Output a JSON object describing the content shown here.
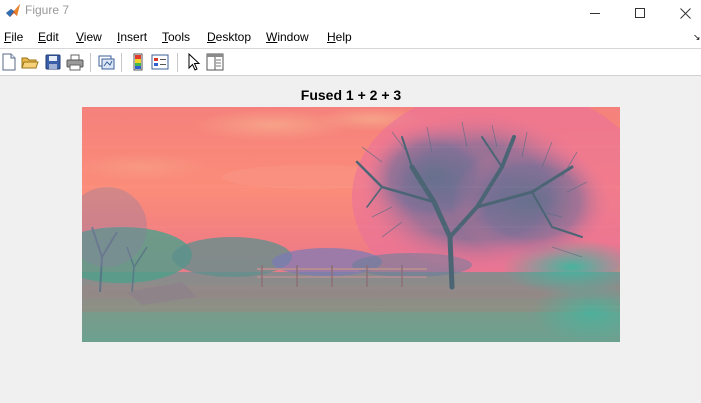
{
  "window": {
    "title": "Figure 7",
    "app_icon": "matlab-icon",
    "controls": [
      "minimize-icon",
      "maximize-icon",
      "close-icon"
    ]
  },
  "menubar": {
    "items": [
      {
        "label": "File",
        "mnemonic": "F",
        "rest": "ile"
      },
      {
        "label": "Edit",
        "mnemonic": "E",
        "rest": "dit"
      },
      {
        "label": "View",
        "mnemonic": "V",
        "rest": "iew"
      },
      {
        "label": "Insert",
        "mnemonic": "I",
        "rest": "nsert"
      },
      {
        "label": "Tools",
        "mnemonic": "T",
        "rest": "ools"
      },
      {
        "label": "Desktop",
        "mnemonic": "D",
        "rest": "esktop"
      },
      {
        "label": "Window",
        "mnemonic": "W",
        "rest": "indow"
      },
      {
        "label": "Help",
        "mnemonic": "H",
        "rest": "elp"
      }
    ]
  },
  "toolbar": {
    "buttons": [
      "new-figure-icon",
      "open-file-icon",
      "save-icon",
      "print-icon",
      "link-plot-icon",
      "insert-colorbar-icon",
      "insert-legend-icon",
      "edit-plot-pointer-icon",
      "property-inspector-icon"
    ]
  },
  "figure": {
    "axes_title": "Fused 1 + 2 + 3",
    "image_description_colors": {
      "sky": "#f98a7c",
      "sky_pink": "#f07a96",
      "tree": "#4f7a8a",
      "ground": "#7a8f7e",
      "ground_teal": "#4fae98"
    }
  }
}
